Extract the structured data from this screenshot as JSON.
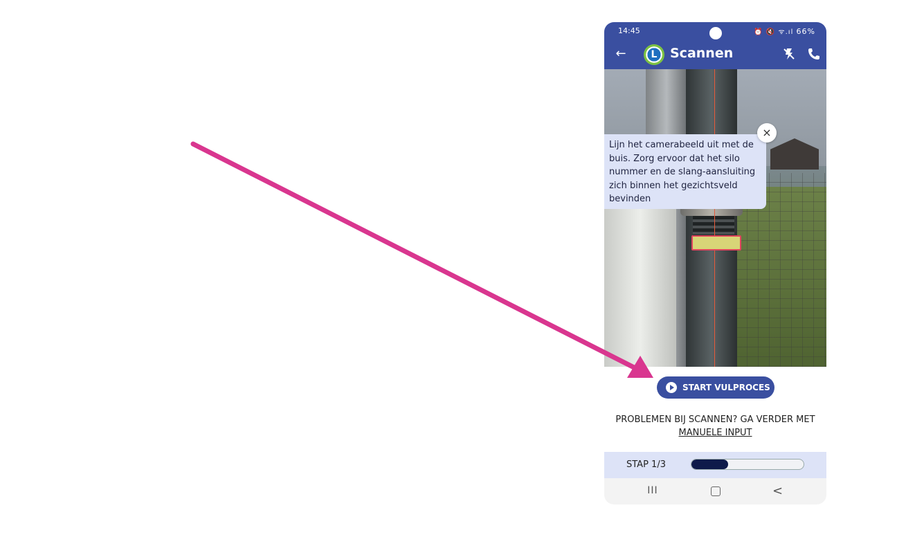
{
  "status_bar": {
    "time": "14:45",
    "icons": "⏰ 🔇 ᯤ.ıl",
    "battery": "66%"
  },
  "app_bar": {
    "title": "Scannen",
    "logo_letter": "L"
  },
  "tooltip": {
    "text": "Lijn het camerabeeld uit met de buis. Zorg ervoor dat het silo nummer en de slang-aansluiting zich binnen het gezichtsveld bevinden",
    "close_symbol": "×"
  },
  "start_button": {
    "label": "START VULPROCES"
  },
  "problem": {
    "text_before": "PROBLEMEN BIJ SCANNEN? GA VERDER MET ",
    "link_label": "MANUELE INPUT"
  },
  "step": {
    "label": "STAP 1/3",
    "progress": 0.33
  },
  "nav": {
    "recent_symbol": "III",
    "back_symbol": "<"
  },
  "colors": {
    "primary": "#3a4fa0",
    "annotation_arrow": "#d9368f",
    "tooltip_bg": "#dde3f7",
    "progress_fill": "#0e1a4a"
  }
}
